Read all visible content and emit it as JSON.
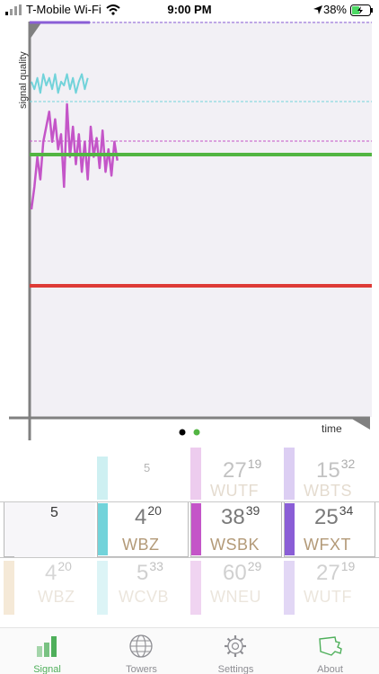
{
  "status": {
    "carrier": "T-Mobile Wi-Fi",
    "time": "9:00 PM",
    "battery": "38%"
  },
  "chart": {
    "ylabel": "signal quality",
    "xlabel": "time",
    "colors": {
      "purple": "#8a5ed6",
      "cyan": "#72d3da",
      "magenta": "#c455c8",
      "green": "#52b542",
      "red": "#de3b36",
      "background": "#f2f0f5"
    }
  },
  "chart_data": {
    "type": "line",
    "title": "",
    "xlabel": "time",
    "ylabel": "signal quality",
    "grid": false,
    "series": [
      {
        "values": [
          10,
          10,
          10,
          10,
          10,
          10
        ]
      },
      {
        "values": [
          8.4,
          8.2,
          8.5,
          8.1,
          8.6,
          8.3,
          8.5,
          8.2,
          8.6,
          8.1,
          8.4,
          8.3,
          8.6,
          8.2,
          8.5,
          8.1,
          8.4,
          8.6,
          8.2,
          8.5
        ]
      },
      {
        "values": [
          5.0,
          5.6,
          6.4,
          5.8,
          6.8,
          7.2,
          7.6,
          6.8,
          7.4,
          6.6,
          7.0,
          5.6,
          7.8,
          6.4,
          7.2,
          6.2,
          7.0,
          6.0,
          6.8,
          5.8,
          7.2,
          6.4,
          6.9,
          6.1,
          7.1,
          6.0,
          6.6,
          5.9,
          6.8,
          6.3
        ]
      },
      {
        "values": [
          7.0,
          7.0
        ]
      },
      {
        "values": [
          3.5,
          3.5
        ]
      }
    ]
  },
  "picker": {
    "columns": [
      {
        "color": "#d9a860",
        "rows": [
          {
            "main": "5",
            "sup": ""
          },
          {
            "main": "4",
            "sup": "20",
            "call": "WBZ"
          }
        ]
      },
      {
        "color": "#72d3da",
        "rows": [
          {
            "main": "5",
            "sup": ""
          },
          {
            "main": "4",
            "sup": "20",
            "call": "WBZ"
          },
          {
            "main": "5",
            "sup": "33",
            "call": "WCVB"
          }
        ]
      },
      {
        "color": "#c455c8",
        "rows": [
          {
            "main": "27",
            "sup": "19",
            "call": "WUTF"
          },
          {
            "main": "38",
            "sup": "39",
            "call": "WSBK"
          },
          {
            "main": "60",
            "sup": "29",
            "call": "WNEU"
          }
        ]
      },
      {
        "color": "#8a5ed6",
        "rows": [
          {
            "main": "15",
            "sup": "32",
            "call": "WBTS"
          },
          {
            "main": "25",
            "sup": "34",
            "call": "WFXT"
          },
          {
            "main": "27",
            "sup": "19",
            "call": "WUTF"
          }
        ]
      }
    ]
  },
  "tabs": [
    {
      "label": "Signal",
      "icon": "signal-bars-icon",
      "active": true
    },
    {
      "label": "Towers",
      "icon": "globe-icon",
      "active": false
    },
    {
      "label": "Settings",
      "icon": "gear-icon",
      "active": false
    },
    {
      "label": "About",
      "icon": "massachusetts-map-icon",
      "active": false
    }
  ]
}
